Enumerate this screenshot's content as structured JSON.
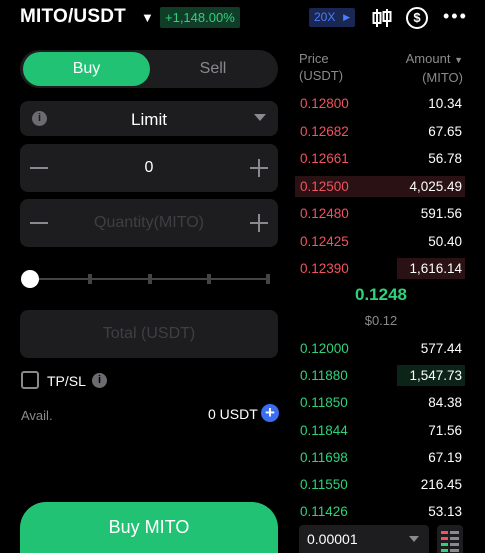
{
  "header": {
    "pair": "MITO/USDT",
    "change": "+1,148.00%",
    "leverage": "20X",
    "icons": [
      "chevron-down-icon",
      "candlestick-icon",
      "dollar-icon",
      "more-icon"
    ]
  },
  "order_form": {
    "tabs": {
      "buy": "Buy",
      "sell": "Sell"
    },
    "order_type": "Limit",
    "price_value": "0",
    "quantity_placeholder": "Quantity(MITO)",
    "total_placeholder": "Total (USDT)",
    "slider_percent": 0,
    "tpsl_label": "TP/SL",
    "avail_label": "Avail.",
    "avail_value": "0 USDT",
    "buy_button": "Buy MITO"
  },
  "order_book": {
    "price_header": "Price",
    "price_unit": "(USDT)",
    "amount_header": "Amount",
    "amount_unit": "(MITO)",
    "asks": [
      {
        "price": "0.12800",
        "amount": "10.34",
        "depth": 0
      },
      {
        "price": "0.12682",
        "amount": "67.65",
        "depth": 0
      },
      {
        "price": "0.12661",
        "amount": "56.78",
        "depth": 0
      },
      {
        "price": "0.12500",
        "amount": "4,025.49",
        "depth": 1.0
      },
      {
        "price": "0.12480",
        "amount": "591.56",
        "depth": 0
      },
      {
        "price": "0.12425",
        "amount": "50.40",
        "depth": 0
      },
      {
        "price": "0.12390",
        "amount": "1,616.14",
        "depth": 0.4
      }
    ],
    "last_price": "0.1248",
    "last_price_usd": "$0.12",
    "bids": [
      {
        "price": "0.12000",
        "amount": "577.44",
        "depth": 0
      },
      {
        "price": "0.11880",
        "amount": "1,547.73",
        "depth": 0.4
      },
      {
        "price": "0.11850",
        "amount": "84.38",
        "depth": 0
      },
      {
        "price": "0.11844",
        "amount": "71.56",
        "depth": 0
      },
      {
        "price": "0.11698",
        "amount": "67.19",
        "depth": 0
      },
      {
        "price": "0.11550",
        "amount": "216.45",
        "depth": 0
      },
      {
        "price": "0.11426",
        "amount": "53.13",
        "depth": 0
      }
    ],
    "depth_precision": "0.00001"
  },
  "colors": {
    "buy_green": "#22c274",
    "ask_red": "#f2525f",
    "bid_green": "#2fd27a",
    "leverage_blue": "#4a7dff"
  }
}
